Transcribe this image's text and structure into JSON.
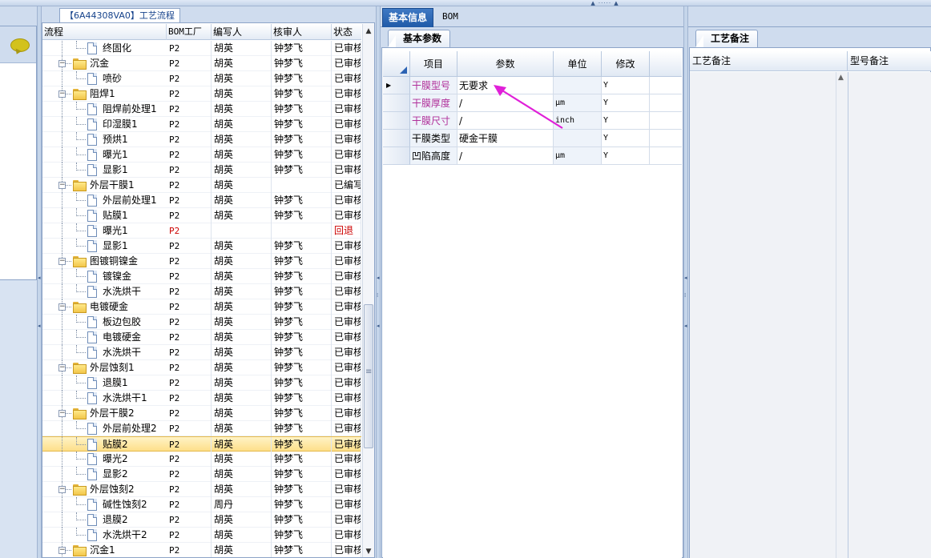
{
  "tree_tab_title": "【6A44308VA0】工艺流程",
  "main_tabs": [
    "基本信息",
    "BOM"
  ],
  "sub_tab_params": "基本参数",
  "sub_tab_notes": "工艺备注",
  "tree_columns": [
    "流程",
    "BOM工厂",
    "编写人",
    "核审人",
    "状态"
  ],
  "tree_rows": [
    {
      "level": 2,
      "type": "doc",
      "name": "终固化",
      "bom": "P2",
      "writer": "胡英",
      "reviewer": "钟梦飞",
      "status": "已审核"
    },
    {
      "level": 1,
      "type": "folder",
      "name": "沉金",
      "bom": "P2",
      "writer": "胡英",
      "reviewer": "钟梦飞",
      "status": "已审核"
    },
    {
      "level": 2,
      "type": "doc",
      "name": "喷砂",
      "bom": "P2",
      "writer": "胡英",
      "reviewer": "钟梦飞",
      "status": "已审核"
    },
    {
      "level": 1,
      "type": "folder",
      "name": "阻焊1",
      "bom": "P2",
      "writer": "胡英",
      "reviewer": "钟梦飞",
      "status": "已审核"
    },
    {
      "level": 2,
      "type": "doc",
      "name": "阻焊前处理1",
      "bom": "P2",
      "writer": "胡英",
      "reviewer": "钟梦飞",
      "status": "已审核"
    },
    {
      "level": 2,
      "type": "doc",
      "name": "印湿膜1",
      "bom": "P2",
      "writer": "胡英",
      "reviewer": "钟梦飞",
      "status": "已审核"
    },
    {
      "level": 2,
      "type": "doc",
      "name": "预烘1",
      "bom": "P2",
      "writer": "胡英",
      "reviewer": "钟梦飞",
      "status": "已审核"
    },
    {
      "level": 2,
      "type": "doc",
      "name": "曝光1",
      "bom": "P2",
      "writer": "胡英",
      "reviewer": "钟梦飞",
      "status": "已审核"
    },
    {
      "level": 2,
      "type": "doc",
      "name": "显影1",
      "bom": "P2",
      "writer": "胡英",
      "reviewer": "钟梦飞",
      "status": "已审核"
    },
    {
      "level": 1,
      "type": "folder",
      "name": "外层干膜1",
      "bom": "P2",
      "writer": "胡英",
      "reviewer": "",
      "status": "已编写"
    },
    {
      "level": 2,
      "type": "doc",
      "name": "外层前处理1",
      "bom": "P2",
      "writer": "胡英",
      "reviewer": "钟梦飞",
      "status": "已审核"
    },
    {
      "level": 2,
      "type": "doc",
      "name": "贴膜1",
      "bom": "P2",
      "writer": "胡英",
      "reviewer": "钟梦飞",
      "status": "已审核"
    },
    {
      "level": 2,
      "type": "doc",
      "name": "曝光1",
      "bom": "P2",
      "writer": "",
      "reviewer": "",
      "status": "回退",
      "red": true
    },
    {
      "level": 2,
      "type": "doc",
      "name": "显影1",
      "bom": "P2",
      "writer": "胡英",
      "reviewer": "钟梦飞",
      "status": "已审核"
    },
    {
      "level": 1,
      "type": "folder",
      "name": "图镀铜镍金",
      "bom": "P2",
      "writer": "胡英",
      "reviewer": "钟梦飞",
      "status": "已审核"
    },
    {
      "level": 2,
      "type": "doc",
      "name": "镀镍金",
      "bom": "P2",
      "writer": "胡英",
      "reviewer": "钟梦飞",
      "status": "已审核"
    },
    {
      "level": 2,
      "type": "doc",
      "name": "水洗烘干",
      "bom": "P2",
      "writer": "胡英",
      "reviewer": "钟梦飞",
      "status": "已审核"
    },
    {
      "level": 1,
      "type": "folder",
      "name": "电镀硬金",
      "bom": "P2",
      "writer": "胡英",
      "reviewer": "钟梦飞",
      "status": "已审核"
    },
    {
      "level": 2,
      "type": "doc",
      "name": "板边包胶",
      "bom": "P2",
      "writer": "胡英",
      "reviewer": "钟梦飞",
      "status": "已审核"
    },
    {
      "level": 2,
      "type": "doc",
      "name": "电镀硬金",
      "bom": "P2",
      "writer": "胡英",
      "reviewer": "钟梦飞",
      "status": "已审核"
    },
    {
      "level": 2,
      "type": "doc",
      "name": "水洗烘干",
      "bom": "P2",
      "writer": "胡英",
      "reviewer": "钟梦飞",
      "status": "已审核"
    },
    {
      "level": 1,
      "type": "folder",
      "name": "外层蚀刻1",
      "bom": "P2",
      "writer": "胡英",
      "reviewer": "钟梦飞",
      "status": "已审核"
    },
    {
      "level": 2,
      "type": "doc",
      "name": "退膜1",
      "bom": "P2",
      "writer": "胡英",
      "reviewer": "钟梦飞",
      "status": "已审核"
    },
    {
      "level": 2,
      "type": "doc",
      "name": "水洗烘干1",
      "bom": "P2",
      "writer": "胡英",
      "reviewer": "钟梦飞",
      "status": "已审核"
    },
    {
      "level": 1,
      "type": "folder",
      "name": "外层干膜2",
      "bom": "P2",
      "writer": "胡英",
      "reviewer": "钟梦飞",
      "status": "已审核"
    },
    {
      "level": 2,
      "type": "doc",
      "name": "外层前处理2",
      "bom": "P2",
      "writer": "胡英",
      "reviewer": "钟梦飞",
      "status": "已审核"
    },
    {
      "level": 2,
      "type": "doc",
      "name": "贴膜2",
      "bom": "P2",
      "writer": "胡英",
      "reviewer": "钟梦飞",
      "status": "已审核",
      "selected": true
    },
    {
      "level": 2,
      "type": "doc",
      "name": "曝光2",
      "bom": "P2",
      "writer": "胡英",
      "reviewer": "钟梦飞",
      "status": "已审核"
    },
    {
      "level": 2,
      "type": "doc",
      "name": "显影2",
      "bom": "P2",
      "writer": "胡英",
      "reviewer": "钟梦飞",
      "status": "已审核"
    },
    {
      "level": 1,
      "type": "folder",
      "name": "外层蚀刻2",
      "bom": "P2",
      "writer": "胡英",
      "reviewer": "钟梦飞",
      "status": "已审核"
    },
    {
      "level": 2,
      "type": "doc",
      "name": "碱性蚀刻2",
      "bom": "P2",
      "writer": "周丹",
      "reviewer": "钟梦飞",
      "status": "已审核"
    },
    {
      "level": 2,
      "type": "doc",
      "name": "退膜2",
      "bom": "P2",
      "writer": "胡英",
      "reviewer": "钟梦飞",
      "status": "已审核"
    },
    {
      "level": 2,
      "type": "doc",
      "name": "水洗烘干2",
      "bom": "P2",
      "writer": "胡英",
      "reviewer": "钟梦飞",
      "status": "已审核"
    },
    {
      "level": 1,
      "type": "folder",
      "name": "沉金1",
      "bom": "P2",
      "writer": "胡英",
      "reviewer": "钟梦飞",
      "status": "已审核"
    }
  ],
  "param_columns": [
    "项目",
    "参数",
    "单位",
    "修改"
  ],
  "param_rows": [
    {
      "item": "干膜型号",
      "value": "无要求",
      "unit": "",
      "mod": "Y",
      "pink": true,
      "current": true
    },
    {
      "item": "干膜厚度",
      "value": "/",
      "unit": "μm",
      "mod": "Y",
      "pink": true
    },
    {
      "item": "干膜尺寸",
      "value": "/",
      "unit": "inch",
      "mod": "Y",
      "pink": true
    },
    {
      "item": "干膜类型",
      "value": "硬金干膜",
      "unit": "",
      "mod": "Y"
    },
    {
      "item": "凹陷高度",
      "value": "/",
      "unit": "μm",
      "mod": "Y"
    }
  ],
  "notes_columns": [
    "工艺备注",
    "型号备注"
  ],
  "colors": {
    "accent": "#1f5aa8",
    "pink_text": "#b0309a",
    "arrow": "#e020d8",
    "reject_red": "#cc0000"
  },
  "icons": [
    "chat-bubble-icon",
    "folder-icon",
    "document-icon",
    "expand-minus-icon",
    "row-pointer-icon"
  ]
}
